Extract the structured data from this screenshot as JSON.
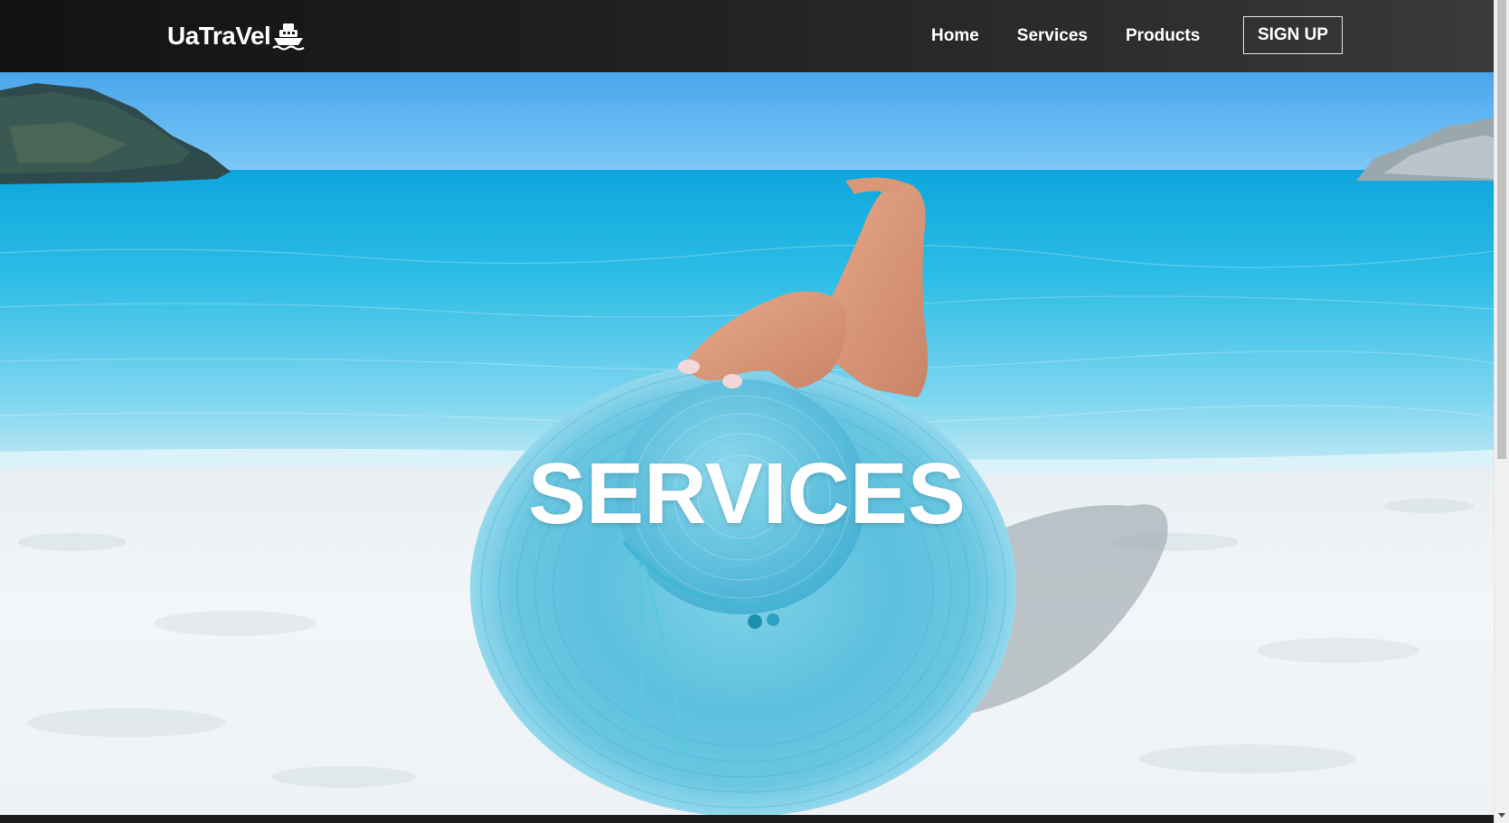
{
  "brand": {
    "name": "UaTraVel",
    "icon": "ship-icon"
  },
  "nav": {
    "items": [
      {
        "label": "Home"
      },
      {
        "label": "Services"
      },
      {
        "label": "Products"
      }
    ],
    "signup_label": "SIGN UP"
  },
  "hero": {
    "title": "SERVICES",
    "image": "beach-hat-photo"
  },
  "colors": {
    "navbar_dark": "#121212",
    "navbar_light": "#3a3a3a",
    "sky": "#5fb4f0",
    "sea": "#29b3e0",
    "sand": "#f2f5f7",
    "hat": "#5ec3e0"
  }
}
